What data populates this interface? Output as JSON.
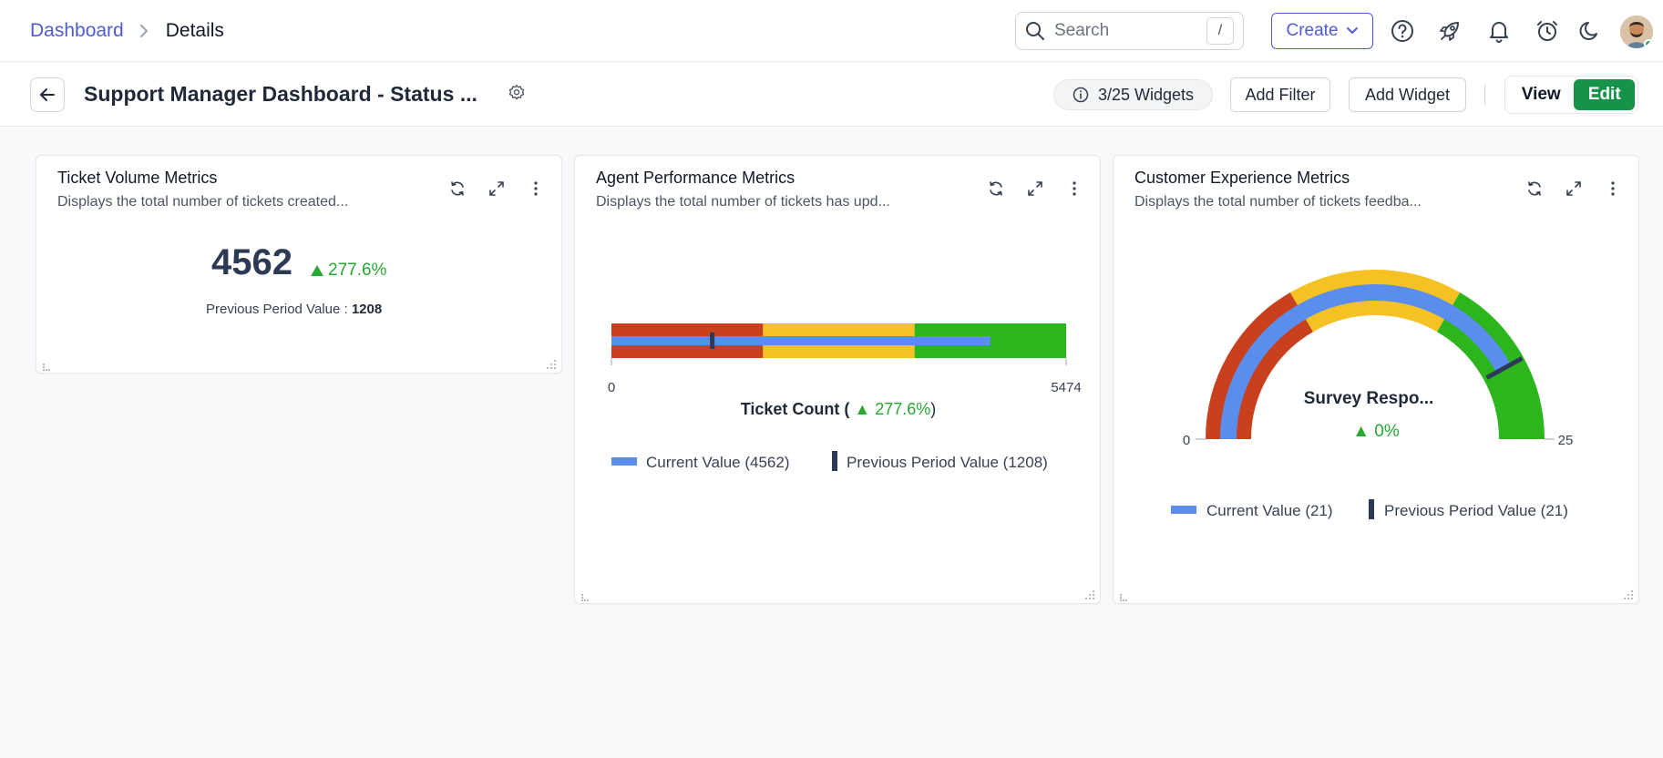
{
  "breadcrumb": {
    "root": "Dashboard",
    "current": "Details"
  },
  "topbar": {
    "search_placeholder": "Search",
    "search_shortcut": "/",
    "create_label": "Create",
    "icons": [
      "help-icon",
      "rocket-icon",
      "bell-icon",
      "alarm-clock-icon",
      "moon-icon"
    ]
  },
  "subbar": {
    "title": "Support Manager Dashboard - Status ...",
    "widgets_count": "3/25 Widgets",
    "add_filter": "Add Filter",
    "add_widget": "Add Widget",
    "view_label": "View",
    "edit_label": "Edit"
  },
  "colors": {
    "accent": "#4f5bd5",
    "edit_green": "#16934a",
    "positive": "#27a831",
    "band_red": "#c9401c",
    "band_yellow": "#f6c223",
    "band_green": "#2cb51c",
    "current_bar": "#5b8def",
    "prev_marker": "#2d3a55"
  },
  "widgets": {
    "ticket_volume": {
      "title": "Ticket Volume Metrics",
      "description": "Displays the total number of tickets created...",
      "value": "4562",
      "delta": "277.6%",
      "prev_label": "Previous Period Value :",
      "prev_value": "1208"
    },
    "agent_performance": {
      "title": "Agent Performance Metrics",
      "description": "Displays the total number of tickets has upd...",
      "metric_label": "Ticket Count",
      "delta": "277.6%",
      "legend_current": "Current Value (4562)",
      "legend_prev": "Previous Period Value (1208)"
    },
    "customer_experience": {
      "title": "Customer Experience Metrics",
      "description": "Displays the total number of tickets feedba...",
      "metric_label": "Survey Respo...",
      "delta": "0%",
      "legend_current": "Current Value (21)",
      "legend_prev": "Previous Period Value (21)"
    }
  },
  "chart_data": [
    {
      "type": "bullet",
      "axis_min": 0,
      "axis_max": 5474,
      "tick_labels": [
        "0",
        "5474"
      ],
      "bands": [
        {
          "from": 0,
          "to": 1825,
          "color": "#c9401c"
        },
        {
          "from": 1825,
          "to": 3649,
          "color": "#f6c223"
        },
        {
          "from": 3649,
          "to": 5474,
          "color": "#2cb51c"
        }
      ],
      "current_value": 4562,
      "previous_value": 1208
    },
    {
      "type": "gauge",
      "axis_min": 0,
      "axis_max": 25,
      "tick_labels": [
        "0",
        "25"
      ],
      "bands": [
        {
          "from": 0,
          "to": 8.33,
          "color": "#c9401c"
        },
        {
          "from": 8.33,
          "to": 16.67,
          "color": "#f6c223"
        },
        {
          "from": 16.67,
          "to": 25,
          "color": "#2cb51c"
        }
      ],
      "current_value": 21,
      "previous_value": 21
    }
  ]
}
